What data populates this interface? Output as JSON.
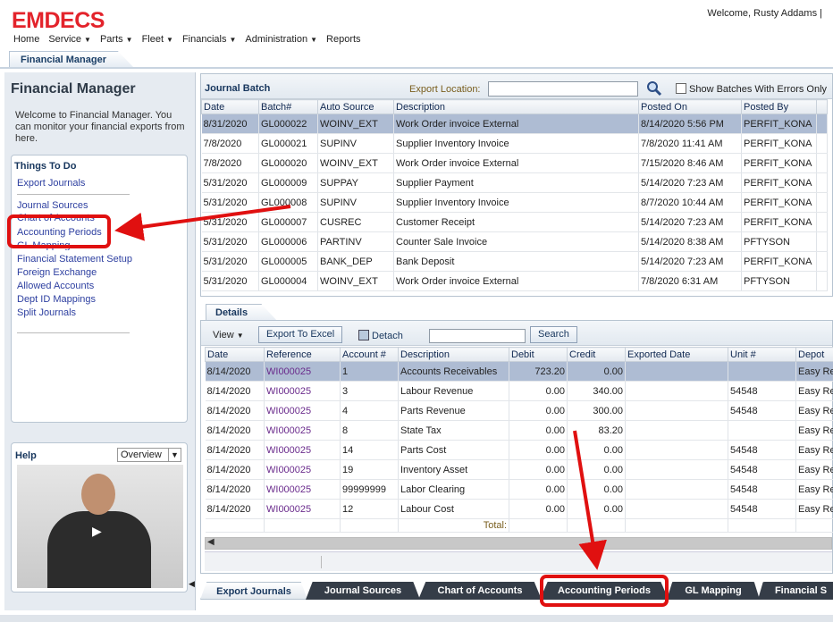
{
  "app": {
    "logo_text": "EMDECS",
    "welcome": "Welcome, Rusty Addams |",
    "colors": {
      "brand_red": "#e3232b",
      "selection": "#aebcd3",
      "annotation": "#e01010"
    }
  },
  "nav": {
    "items": [
      {
        "label": "Home",
        "dropdown": false
      },
      {
        "label": "Service",
        "dropdown": true
      },
      {
        "label": "Parts",
        "dropdown": true
      },
      {
        "label": "Fleet",
        "dropdown": true
      },
      {
        "label": "Financials",
        "dropdown": true
      },
      {
        "label": "Administration",
        "dropdown": true
      },
      {
        "label": "Reports",
        "dropdown": false
      }
    ]
  },
  "page_tab": "Financial Manager",
  "left": {
    "title": "Financial Manager",
    "welcome": "Welcome to Financial Manager. You can monitor your financial exports from here.",
    "things": {
      "title": "Things To Do",
      "links": [
        "Export Journals",
        "Journal Sources",
        "Chart of Accounts",
        "Accounting Periods",
        "GL Mapping",
        "Financial Statement Setup",
        "Foreign Exchange",
        "Allowed Accounts",
        "Dept ID Mappings",
        "Split Journals"
      ]
    },
    "help": {
      "title": "Help",
      "selected": "Overview"
    }
  },
  "journal_batch": {
    "title": "Journal Batch",
    "export_location_label": "Export Location:",
    "export_location_value": "",
    "show_errors_label": "Show Batches With Errors Only",
    "columns": [
      "Date",
      "Batch#",
      "Auto Source",
      "Description",
      "Posted On",
      "Posted By"
    ],
    "rows": [
      [
        "8/31/2020",
        "GL000022",
        "WOINV_EXT",
        "Work Order invoice External",
        "8/14/2020 5:56 PM",
        "PERFIT_KONA"
      ],
      [
        "7/8/2020",
        "GL000021",
        "SUPINV",
        "Supplier Inventory Invoice",
        "7/8/2020 11:41 AM",
        "PERFIT_KONA"
      ],
      [
        "7/8/2020",
        "GL000020",
        "WOINV_EXT",
        "Work Order invoice External",
        "7/15/2020 8:46 AM",
        "PERFIT_KONA"
      ],
      [
        "5/31/2020",
        "GL000009",
        "SUPPAY",
        "Supplier Payment",
        "5/14/2020 7:23 AM",
        "PERFIT_KONA"
      ],
      [
        "5/31/2020",
        "GL000008",
        "SUPINV",
        "Supplier Inventory Invoice",
        "8/7/2020 10:44 AM",
        "PERFIT_KONA"
      ],
      [
        "5/31/2020",
        "GL000007",
        "CUSREC",
        "Customer Receipt",
        "5/14/2020 7:23 AM",
        "PERFIT_KONA"
      ],
      [
        "5/31/2020",
        "GL000006",
        "PARTINV",
        "Counter Sale Invoice",
        "5/14/2020 8:38 AM",
        "PFTYSON"
      ],
      [
        "5/31/2020",
        "GL000005",
        "BANK_DEP",
        "Bank Deposit",
        "5/14/2020 7:23 AM",
        "PERFIT_KONA"
      ],
      [
        "5/31/2020",
        "GL000004",
        "WOINV_EXT",
        "Work Order invoice External",
        "7/8/2020 6:31 AM",
        "PFTYSON"
      ]
    ]
  },
  "details": {
    "tab": "Details",
    "toolbar": {
      "view": "View",
      "export_excel": "Export To Excel",
      "detach": "Detach",
      "search": "Search",
      "search_value": ""
    },
    "columns": [
      "Date",
      "Reference",
      "Account #",
      "Description",
      "Debit",
      "Credit",
      "Exported Date",
      "Unit #",
      "Depot"
    ],
    "rows": [
      [
        "8/14/2020",
        "WI000025",
        "1",
        "Accounts Receivables",
        "723.20",
        "0.00",
        "",
        "",
        "Easy Re"
      ],
      [
        "8/14/2020",
        "WI000025",
        "3",
        "Labour Revenue",
        "0.00",
        "340.00",
        "",
        "54548",
        "Easy Re"
      ],
      [
        "8/14/2020",
        "WI000025",
        "4",
        "Parts Revenue",
        "0.00",
        "300.00",
        "",
        "54548",
        "Easy Re"
      ],
      [
        "8/14/2020",
        "WI000025",
        "8",
        "State Tax",
        "0.00",
        "83.20",
        "",
        "",
        "Easy Re"
      ],
      [
        "8/14/2020",
        "WI000025",
        "14",
        "Parts Cost",
        "0.00",
        "0.00",
        "",
        "54548",
        "Easy Re"
      ],
      [
        "8/14/2020",
        "WI000025",
        "19",
        "Inventory Asset",
        "0.00",
        "0.00",
        "",
        "54548",
        "Easy Re"
      ],
      [
        "8/14/2020",
        "WI000025",
        "99999999",
        "Labor Clearing",
        "0.00",
        "0.00",
        "",
        "54548",
        "Easy Re"
      ],
      [
        "8/14/2020",
        "WI000025",
        "12",
        "Labour Cost",
        "0.00",
        "0.00",
        "",
        "54548",
        "Easy Re"
      ]
    ],
    "total_label": "Total:"
  },
  "bottom_tabs": [
    "Export Journals",
    "Journal Sources",
    "Chart of Accounts",
    "Accounting Periods",
    "GL Mapping",
    "Financial S"
  ]
}
